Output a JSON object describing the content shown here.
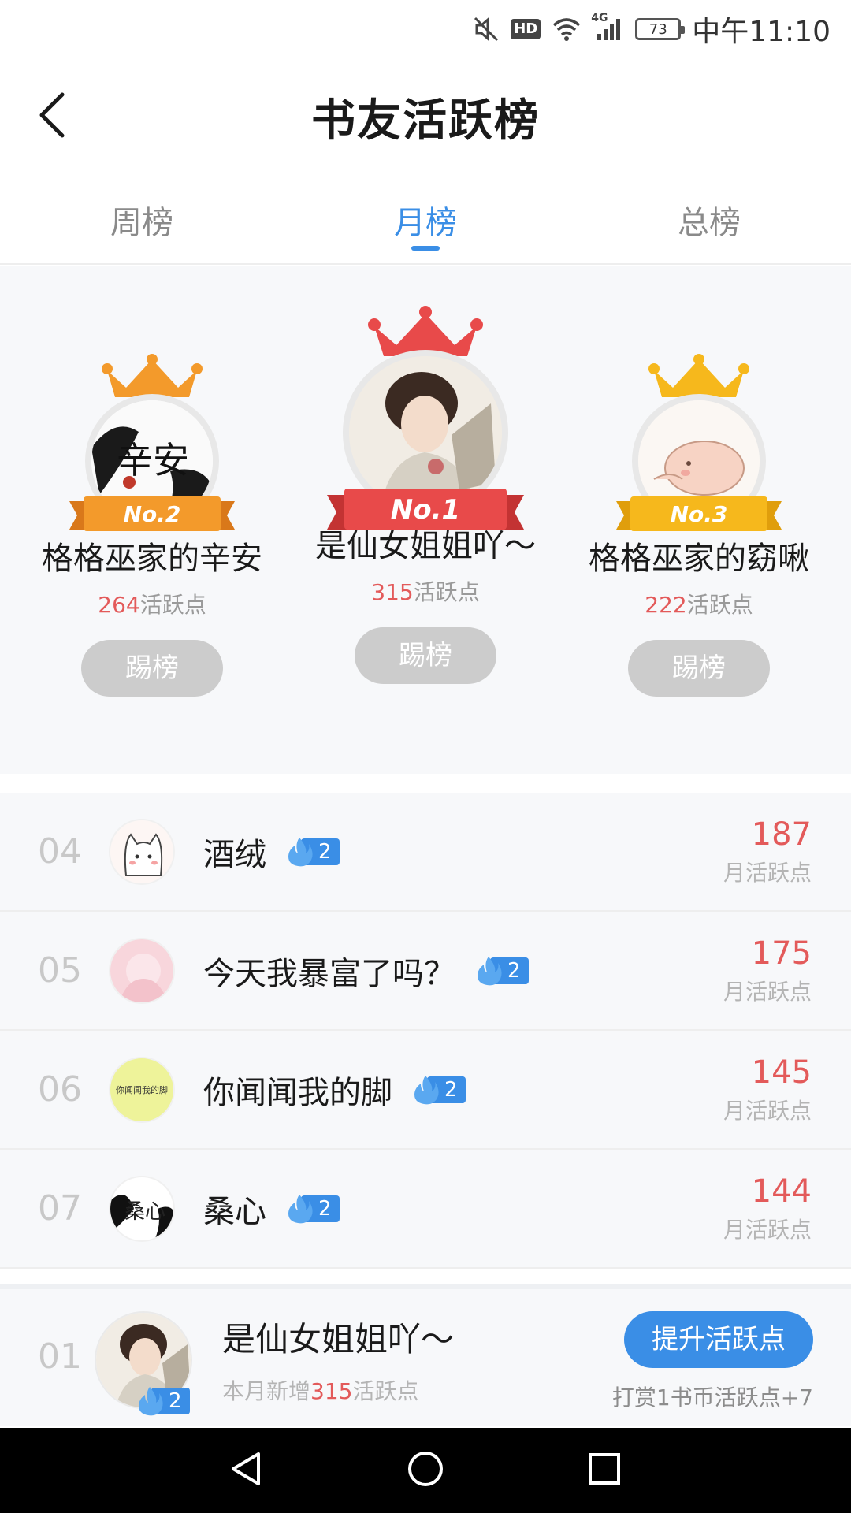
{
  "status_bar": {
    "battery_level": "73",
    "time": "中午11:10",
    "hd_label": "HD",
    "network_label": "4G",
    "icons": [
      "mute-icon",
      "hd-icon",
      "wifi-icon",
      "signal-icon",
      "battery-icon"
    ]
  },
  "header": {
    "title": "书友活跃榜",
    "back_icon": "chevron-left-icon"
  },
  "tabs": [
    {
      "label": "周榜",
      "active": false
    },
    {
      "label": "月榜",
      "active": true
    },
    {
      "label": "总榜",
      "active": false
    }
  ],
  "podium": {
    "first": {
      "rank": "No.1",
      "name": "是仙女姐姐吖～",
      "points": "315",
      "points_suffix": "活跃点",
      "button": "踢榜",
      "color": "#e84a4a"
    },
    "second": {
      "rank": "No.2",
      "name": "格格巫家的辛安",
      "points": "264",
      "points_suffix": "活跃点",
      "button": "踢榜",
      "color": "#f39a2b"
    },
    "third": {
      "rank": "No.3",
      "name": "格格巫家的窈啾",
      "points": "222",
      "points_suffix": "活跃点",
      "button": "踢榜",
      "color": "#f6b81c"
    }
  },
  "list": [
    {
      "rank": "04",
      "name": "酒绒",
      "level": "2",
      "points": "187",
      "points_label": "月活跃点"
    },
    {
      "rank": "05",
      "name": "今天我暴富了吗？",
      "level": "2",
      "points": "175",
      "points_label": "月活跃点"
    },
    {
      "rank": "06",
      "name": "你闻闻我的脚",
      "level": "2",
      "points": "145",
      "points_label": "月活跃点"
    },
    {
      "rank": "07",
      "name": "桑心",
      "level": "2",
      "points": "144",
      "points_label": "月活跃点"
    }
  ],
  "avatar_texts": {
    "second": "辛安",
    "row_06": "你闻闻我的脚",
    "row_07": "桑心"
  },
  "mine": {
    "rank": "01",
    "name": "是仙女姐姐吖～",
    "level": "2",
    "sub_prefix": "本月新增",
    "sub_points": "315",
    "sub_suffix": "活跃点",
    "boost_button": "提升活跃点",
    "boost_hint": "打赏1书币活跃点+7"
  },
  "colors": {
    "accent": "#3a8ee6",
    "points_red": "#e35a5a",
    "muted": "#b4b4b4"
  }
}
